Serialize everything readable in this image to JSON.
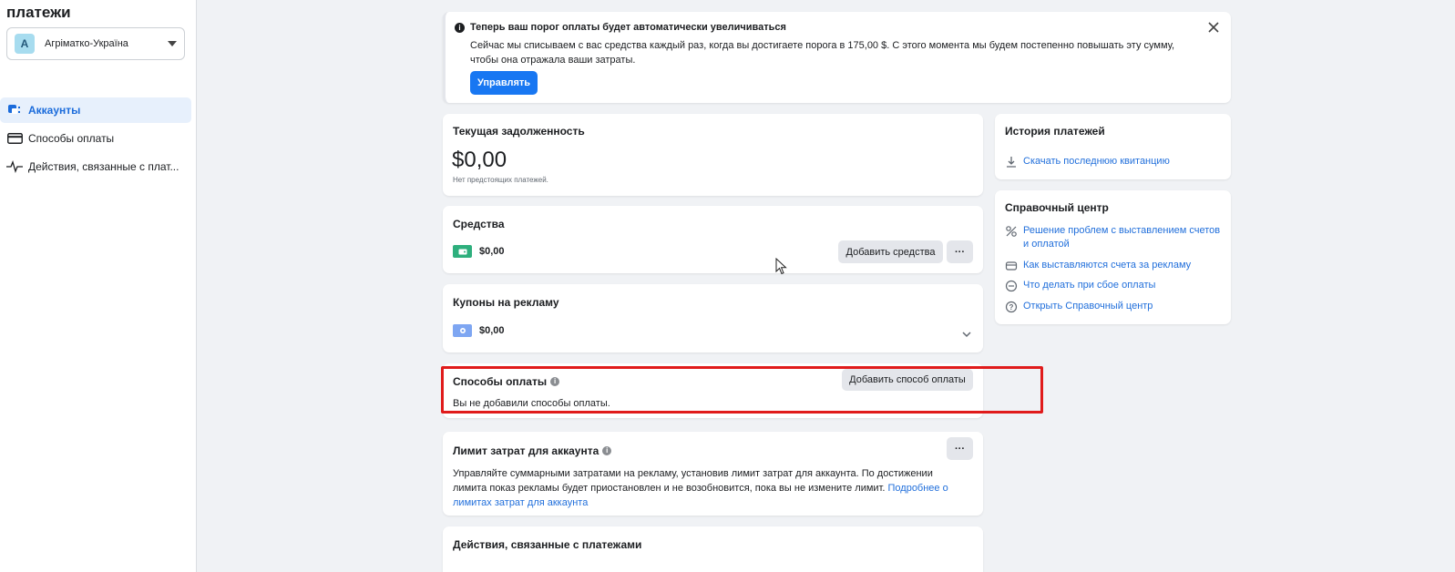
{
  "sidebar": {
    "title": "платежи",
    "account": {
      "avatar_letter": "A",
      "name": "Агрiматко-Україна"
    },
    "items": [
      {
        "label": "Аккаунты",
        "icon": "accounts-icon",
        "active": true
      },
      {
        "label": "Способы оплаты",
        "icon": "card-icon",
        "active": false
      },
      {
        "label": "Действия, связанные с плат...",
        "icon": "activity-icon",
        "active": false
      }
    ]
  },
  "notice": {
    "title": "Теперь ваш порог оплаты будет автоматически увеличиваться",
    "body": "Сейчас мы списываем с вас средства каждый раз, когда вы достигаете порога в 175,00 $. С этого момента мы будем постепенно повышать эту сумму, чтобы она отражала ваши затраты.",
    "button": "Управлять"
  },
  "balance": {
    "title": "Текущая задолженность",
    "amount": "$0,00",
    "note": "Нет предстоящих платежей."
  },
  "funds": {
    "title": "Средства",
    "amount": "$0,00",
    "button": "Добавить средства",
    "more": "···"
  },
  "coupons": {
    "title": "Купоны на рекламу",
    "amount": "$0,00"
  },
  "payment_methods": {
    "title": "Способы оплаты",
    "button": "Добавить способ оплаты",
    "empty": "Вы не добавили способы оплаты."
  },
  "spend_limit": {
    "title": "Лимит затрат для аккаунта",
    "more": "···",
    "body": "Управляйте суммарными затратами на рекламу, установив лимит затрат для аккаунта. По достижении лимита показ рекламы будет приостановлен и не возобновится, пока вы не измените лимит.",
    "link": "Подробнее о лимитах затрат для аккаунта"
  },
  "activity": {
    "title": "Действия, связанные с платежами"
  },
  "history": {
    "title": "История платежей",
    "link": "Скачать последнюю квитанцию"
  },
  "help": {
    "title": "Справочный центр",
    "links": [
      "Решение проблем с выставлением счетов и оплатой",
      "Как выставляются счета за рекламу",
      "Что делать при сбое оплаты",
      "Открыть Справочный центр"
    ]
  },
  "colors": {
    "accent": "#1877f2",
    "link": "#216fdb",
    "highlight": "#e01b1b",
    "funds_icon": "#2eaf7d",
    "coupon_icon": "#7ea6f2"
  }
}
